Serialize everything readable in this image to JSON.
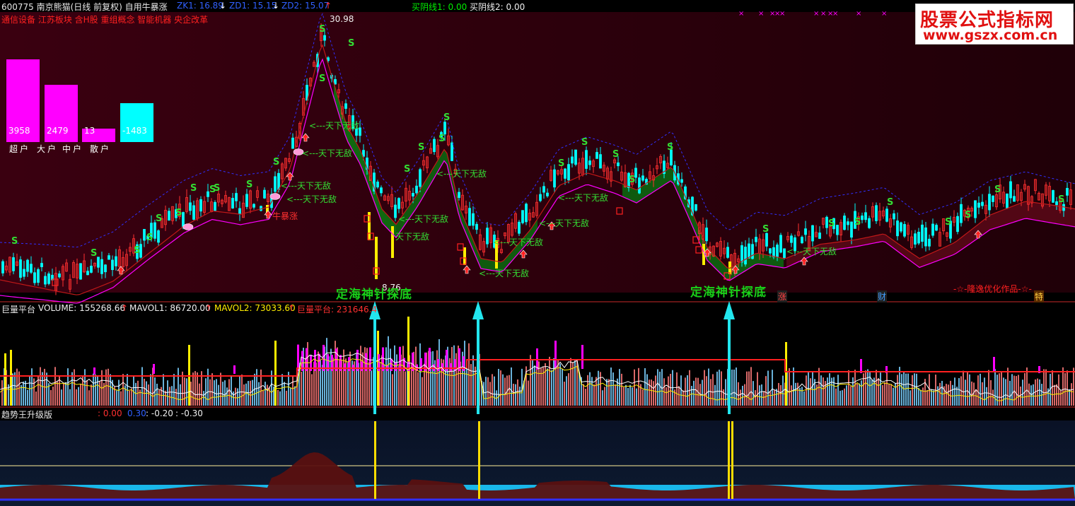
{
  "header": {
    "stock": "600775 南京熊猫(日线 前复权) 自用牛暴涨",
    "zk1": "ZK1: 16.89",
    "zd1": "ZD1: 15.15",
    "zd2": "ZD2: 15.07",
    "maiyin1": "买阴线1: 0.00",
    "maiyin2": "买阴线2: 0.00"
  },
  "concepts": "通信设备 江苏板块 含H股 重组概念 智能机器 央企改革",
  "fund_bars": [
    {
      "label": "超户",
      "value": "3958",
      "color": "#ff00ff"
    },
    {
      "label": "大户",
      "value": "2479",
      "color": "#ff00ff"
    },
    {
      "label": "中户",
      "value": "13",
      "color": "#ff00ff"
    },
    {
      "label": "散户",
      "value": "-1483",
      "color": "#00ffff"
    }
  ],
  "price_labels": {
    "high": "30.98",
    "low": "8.76"
  },
  "signals": {
    "tianxia": "<---天下无敌",
    "tianxia_short": "天下无敌",
    "niubao": "牛暴涨"
  },
  "annotations": {
    "dinghai": "定海神针探底",
    "author": "-☆-隆逸优化作品-☆-",
    "zhang": "涨",
    "cai": "财",
    "te": "特"
  },
  "volume_panel": {
    "title": "巨量平台",
    "volume": "VOLUME: 155268.66",
    "mavol1": "MAVOL1: 86720.00",
    "mavol2": "MAVOL2: 73033.60",
    "juliang": "巨量平台: 231646.4"
  },
  "trend_panel": {
    "title": "趋势王升级版",
    "v1": ": 0.00",
    "v2": "0.30",
    "v3": ": -0.20",
    "v4": ": -0.30"
  },
  "watermark": {
    "line1": "股票公式指标网",
    "line2": "www.gszx.com.cn"
  },
  "colors": {
    "up": "#ff3030",
    "down": "#00ffff",
    "ma": "#ff00ff",
    "dash": "#3030ff",
    "green_band": "#0a6a0a",
    "maroon_bg": "#3c0008",
    "signal": "#33dd33",
    "yellow": "#ffee00",
    "cyan_arrow": "#22e6ee"
  }
}
